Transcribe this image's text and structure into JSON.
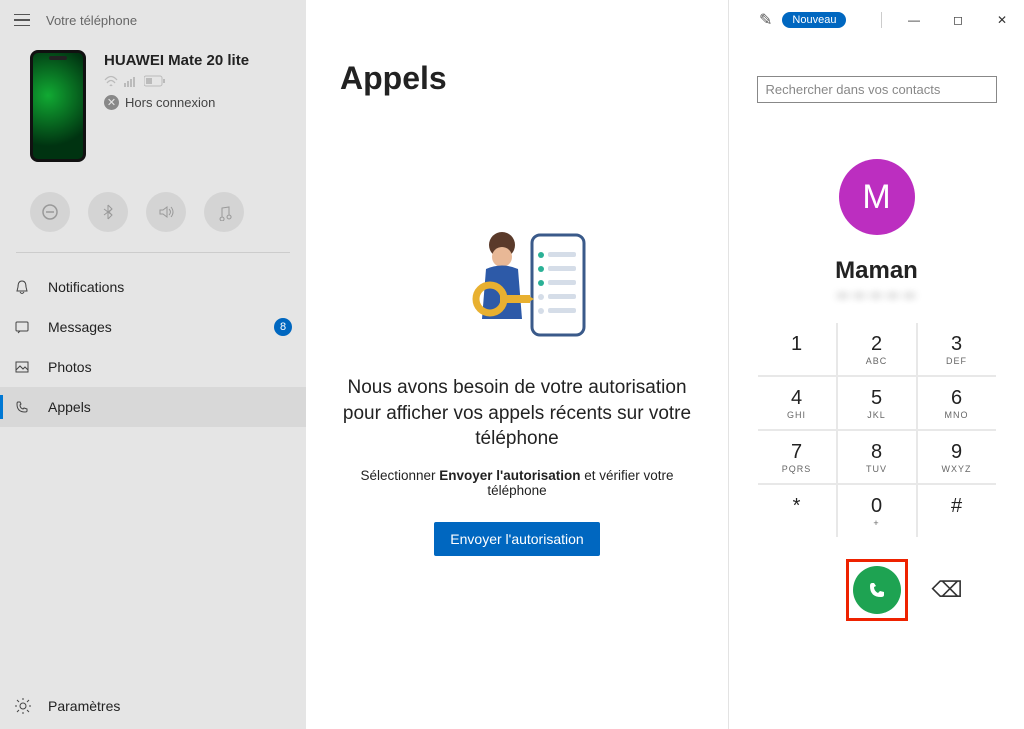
{
  "header": {
    "app_title": "Votre téléphone",
    "new_badge": "Nouveau"
  },
  "device": {
    "name": "HUAWEI Mate 20 lite",
    "status": "Hors connexion"
  },
  "nav": {
    "items": [
      {
        "label": "Notifications"
      },
      {
        "label": "Messages",
        "badge": "8"
      },
      {
        "label": "Photos"
      },
      {
        "label": "Appels"
      }
    ],
    "settings": "Paramètres"
  },
  "main": {
    "title": "Appels",
    "perm_heading": "Nous avons besoin de votre autorisation pour afficher vos appels récents sur votre téléphone",
    "perm_sub_prefix": "Sélectionner ",
    "perm_sub_bold": "Envoyer l'autorisation",
    "perm_sub_suffix": " et vérifier votre téléphone",
    "send_button": "Envoyer l'autorisation"
  },
  "dialer": {
    "search_placeholder": "Rechercher dans vos contacts",
    "avatar_initial": "M",
    "contact_name": "Maman",
    "contact_number": "•• •• •• •• ••",
    "keys": [
      {
        "d": "1",
        "l": ""
      },
      {
        "d": "2",
        "l": "ABC"
      },
      {
        "d": "3",
        "l": "DEF"
      },
      {
        "d": "4",
        "l": "GHI"
      },
      {
        "d": "5",
        "l": "JKL"
      },
      {
        "d": "6",
        "l": "MNO"
      },
      {
        "d": "7",
        "l": "PQRS"
      },
      {
        "d": "8",
        "l": "TUV"
      },
      {
        "d": "9",
        "l": "WXYZ"
      },
      {
        "d": "*",
        "l": ""
      },
      {
        "d": "0",
        "l": "+"
      },
      {
        "d": "#",
        "l": ""
      }
    ]
  }
}
